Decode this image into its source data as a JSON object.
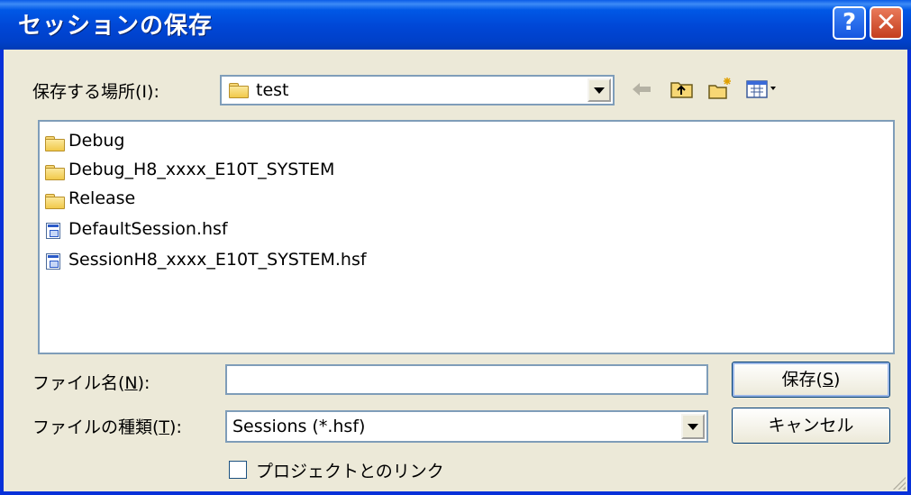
{
  "window": {
    "title": "セッションの保存",
    "help_glyph": "?",
    "close_glyph": "✕"
  },
  "location": {
    "label": "保存する場所",
    "shortcut": "(I):",
    "selected": "test",
    "folder_icon": "folder-icon",
    "toolbar": [
      "back-arrow-icon",
      "up-folder-icon",
      "new-folder-icon",
      "view-menu-icon"
    ]
  },
  "files": [
    {
      "name": "Debug",
      "icon": "folder-icon"
    },
    {
      "name": "Debug_H8_xxxx_E10T_SYSTEM",
      "icon": "folder-icon"
    },
    {
      "name": "Release",
      "icon": "folder-icon"
    },
    {
      "name": "DefaultSession.hsf",
      "icon": "session-file-icon"
    },
    {
      "name": "SessionH8_xxxx_E10T_SYSTEM.hsf",
      "icon": "session-file-icon"
    }
  ],
  "filename": {
    "label": "ファイル名(",
    "key": "N",
    "suffix": "):",
    "value": ""
  },
  "filetype": {
    "label": "ファイルの種類(",
    "key": "T",
    "suffix": "):",
    "selected": "Sessions (*.hsf)"
  },
  "buttons": {
    "save_prefix": "保存(",
    "save_key": "S",
    "save_suffix": ")",
    "cancel": "キャンセル"
  },
  "link_checkbox": {
    "label": "プロジェクトとのリンク",
    "checked": false
  },
  "colors": {
    "titlebar": "#0054e3",
    "face": "#ece9d8",
    "border": "#7f9db9"
  }
}
